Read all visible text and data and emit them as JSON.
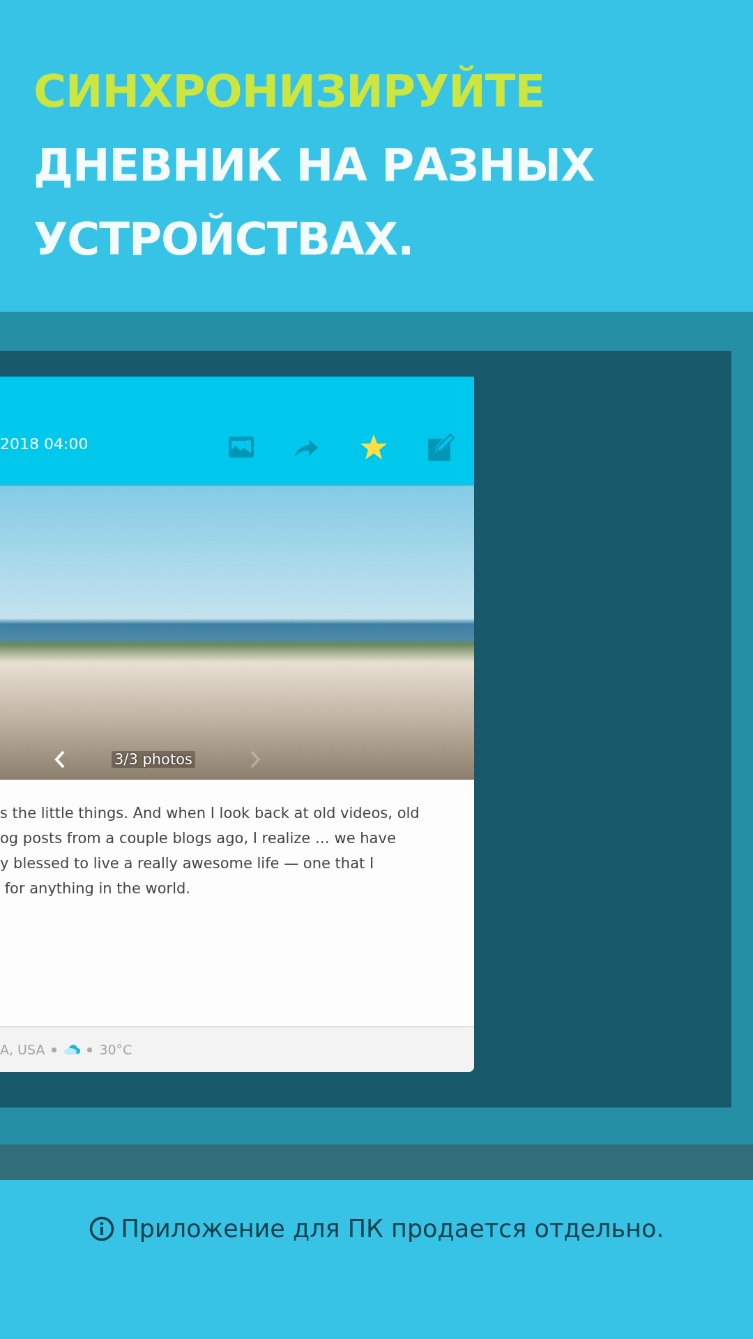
{
  "headline": {
    "accent": "СИНХРОНИЗИРУЙТЕ",
    "rest": [
      "ДНЕВНИК НА РАЗНЫХ",
      "УСТРОЙСТВАХ."
    ]
  },
  "entry": {
    "date": "2018 04:00",
    "starred": true,
    "photo": {
      "caption": "3/3 photos",
      "prev_disabled": false,
      "next_disabled": true
    },
    "body": [
      "s the little things. And when I look back at old videos, old",
      "og posts from a couple blogs ago, I realize … we have",
      "y blessed to live a really awesome life — one that I",
      " for anything in the world."
    ],
    "footer": {
      "location": "A, USA",
      "temperature": "30°C"
    }
  },
  "note": "Приложение для ПК продается отдельно."
}
